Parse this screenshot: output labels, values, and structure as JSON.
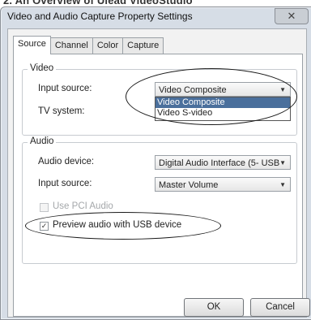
{
  "caption": "2. An Overview of Ulead VideoStudio",
  "window": {
    "title": "Video and Audio Capture Property Settings",
    "close_glyph": "✕"
  },
  "tabs": [
    "Source",
    "Channel",
    "Color",
    "Capture"
  ],
  "video": {
    "group_label": "Video",
    "input_source_label": "Input source:",
    "input_source_value": "Video Composite",
    "tv_system_label": "TV system:",
    "options": [
      "Video Composite",
      "Video S-video"
    ]
  },
  "audio": {
    "group_label": "Audio",
    "device_label": "Audio device:",
    "device_value": "Digital Audio Interface (5- USB",
    "input_source_label": "Input source:",
    "input_source_value": "Master Volume",
    "use_pci_label": "Use PCI Audio",
    "preview_label": "Preview audio with USB device"
  },
  "buttons": {
    "ok": "OK",
    "cancel": "Cancel"
  },
  "icons": {
    "dropdown_arrow": "▼",
    "check": "✓"
  }
}
